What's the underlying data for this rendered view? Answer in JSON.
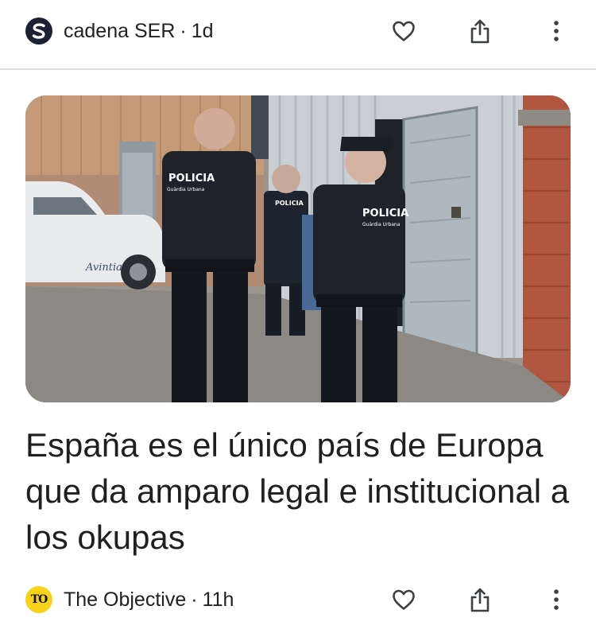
{
  "top_card": {
    "source_name": "cadena SER",
    "separator": "·",
    "age": "1d",
    "logo_icon": "cadena-ser-logo",
    "actions": [
      "heart-icon",
      "share-icon",
      "more-vert-icon"
    ]
  },
  "article": {
    "image_alt": "Police officers of Guardia Urbana in front of a warehouse door",
    "photo_text": {
      "badge_left": "POLICIA",
      "badge_left_sub": "Guàrdia Urbana",
      "badge_mid": "POLICIA",
      "badge_right": "POLICIA",
      "badge_right_sub": "Guàrdia Urbana",
      "car_brand": "Avintia"
    },
    "headline": "España es el único país de Europa que da amparo legal e institucional a los okupas"
  },
  "bottom_card": {
    "logo_text": "TO",
    "source_name": "The Objective",
    "separator": "·",
    "age": "11h",
    "actions": [
      "heart-icon",
      "share-icon",
      "more-vert-icon"
    ]
  },
  "colors": {
    "text": "#1f1f1f",
    "ser_logo_bg": "#1c2233",
    "to_logo_bg": "#f6d21a",
    "divider": "#dedede"
  }
}
